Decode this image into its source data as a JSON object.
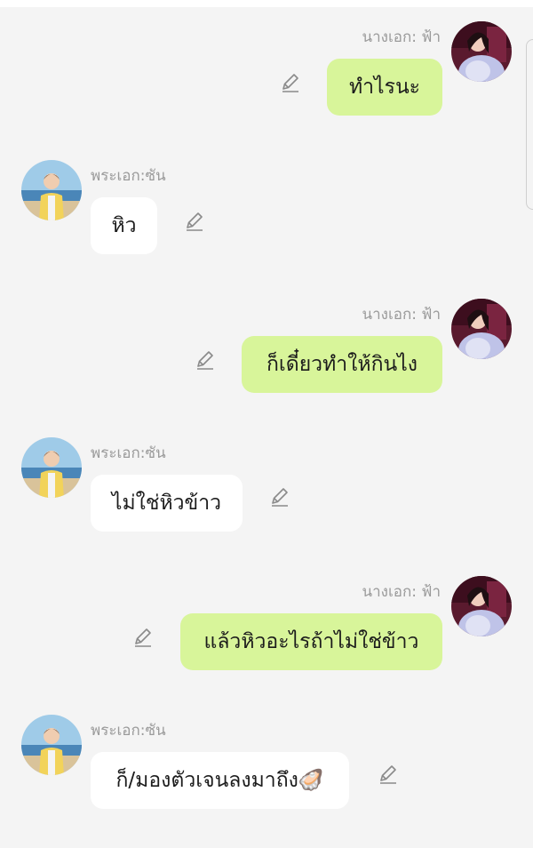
{
  "chat": {
    "messages": [
      {
        "side": "right",
        "sender": "นางเอก: ฟ้า",
        "text": "ทำไรนะ",
        "avatar_icon": "girl-avatar"
      },
      {
        "side": "left",
        "sender": "พระเอก:ซัน",
        "text": "หิว",
        "avatar_icon": "boy-avatar"
      },
      {
        "side": "right",
        "sender": "นางเอก: ฟ้า",
        "text": "ก็เดี๋ยวทำให้กินไง",
        "avatar_icon": "girl-avatar"
      },
      {
        "side": "left",
        "sender": "พระเอก:ซัน",
        "text": "ไม่ใช่หิวข้าว",
        "avatar_icon": "boy-avatar"
      },
      {
        "side": "right",
        "sender": "นางเอก: ฟ้า",
        "text": "แล้วหิวอะไรถ้าไม่ใช่ข้าว",
        "avatar_icon": "girl-avatar"
      },
      {
        "side": "left",
        "sender": "พระเอก:ซัน",
        "text": "ก็/มองตัวเจนลงมาถึง🦪",
        "avatar_icon": "boy-avatar"
      }
    ]
  },
  "colors": {
    "right_bubble": "#d8f59a",
    "left_bubble": "#ffffff",
    "background": "#f4f4f4",
    "sender_name": "#9a9a9a"
  },
  "icons": {
    "edit": "pencil-edit-icon"
  }
}
